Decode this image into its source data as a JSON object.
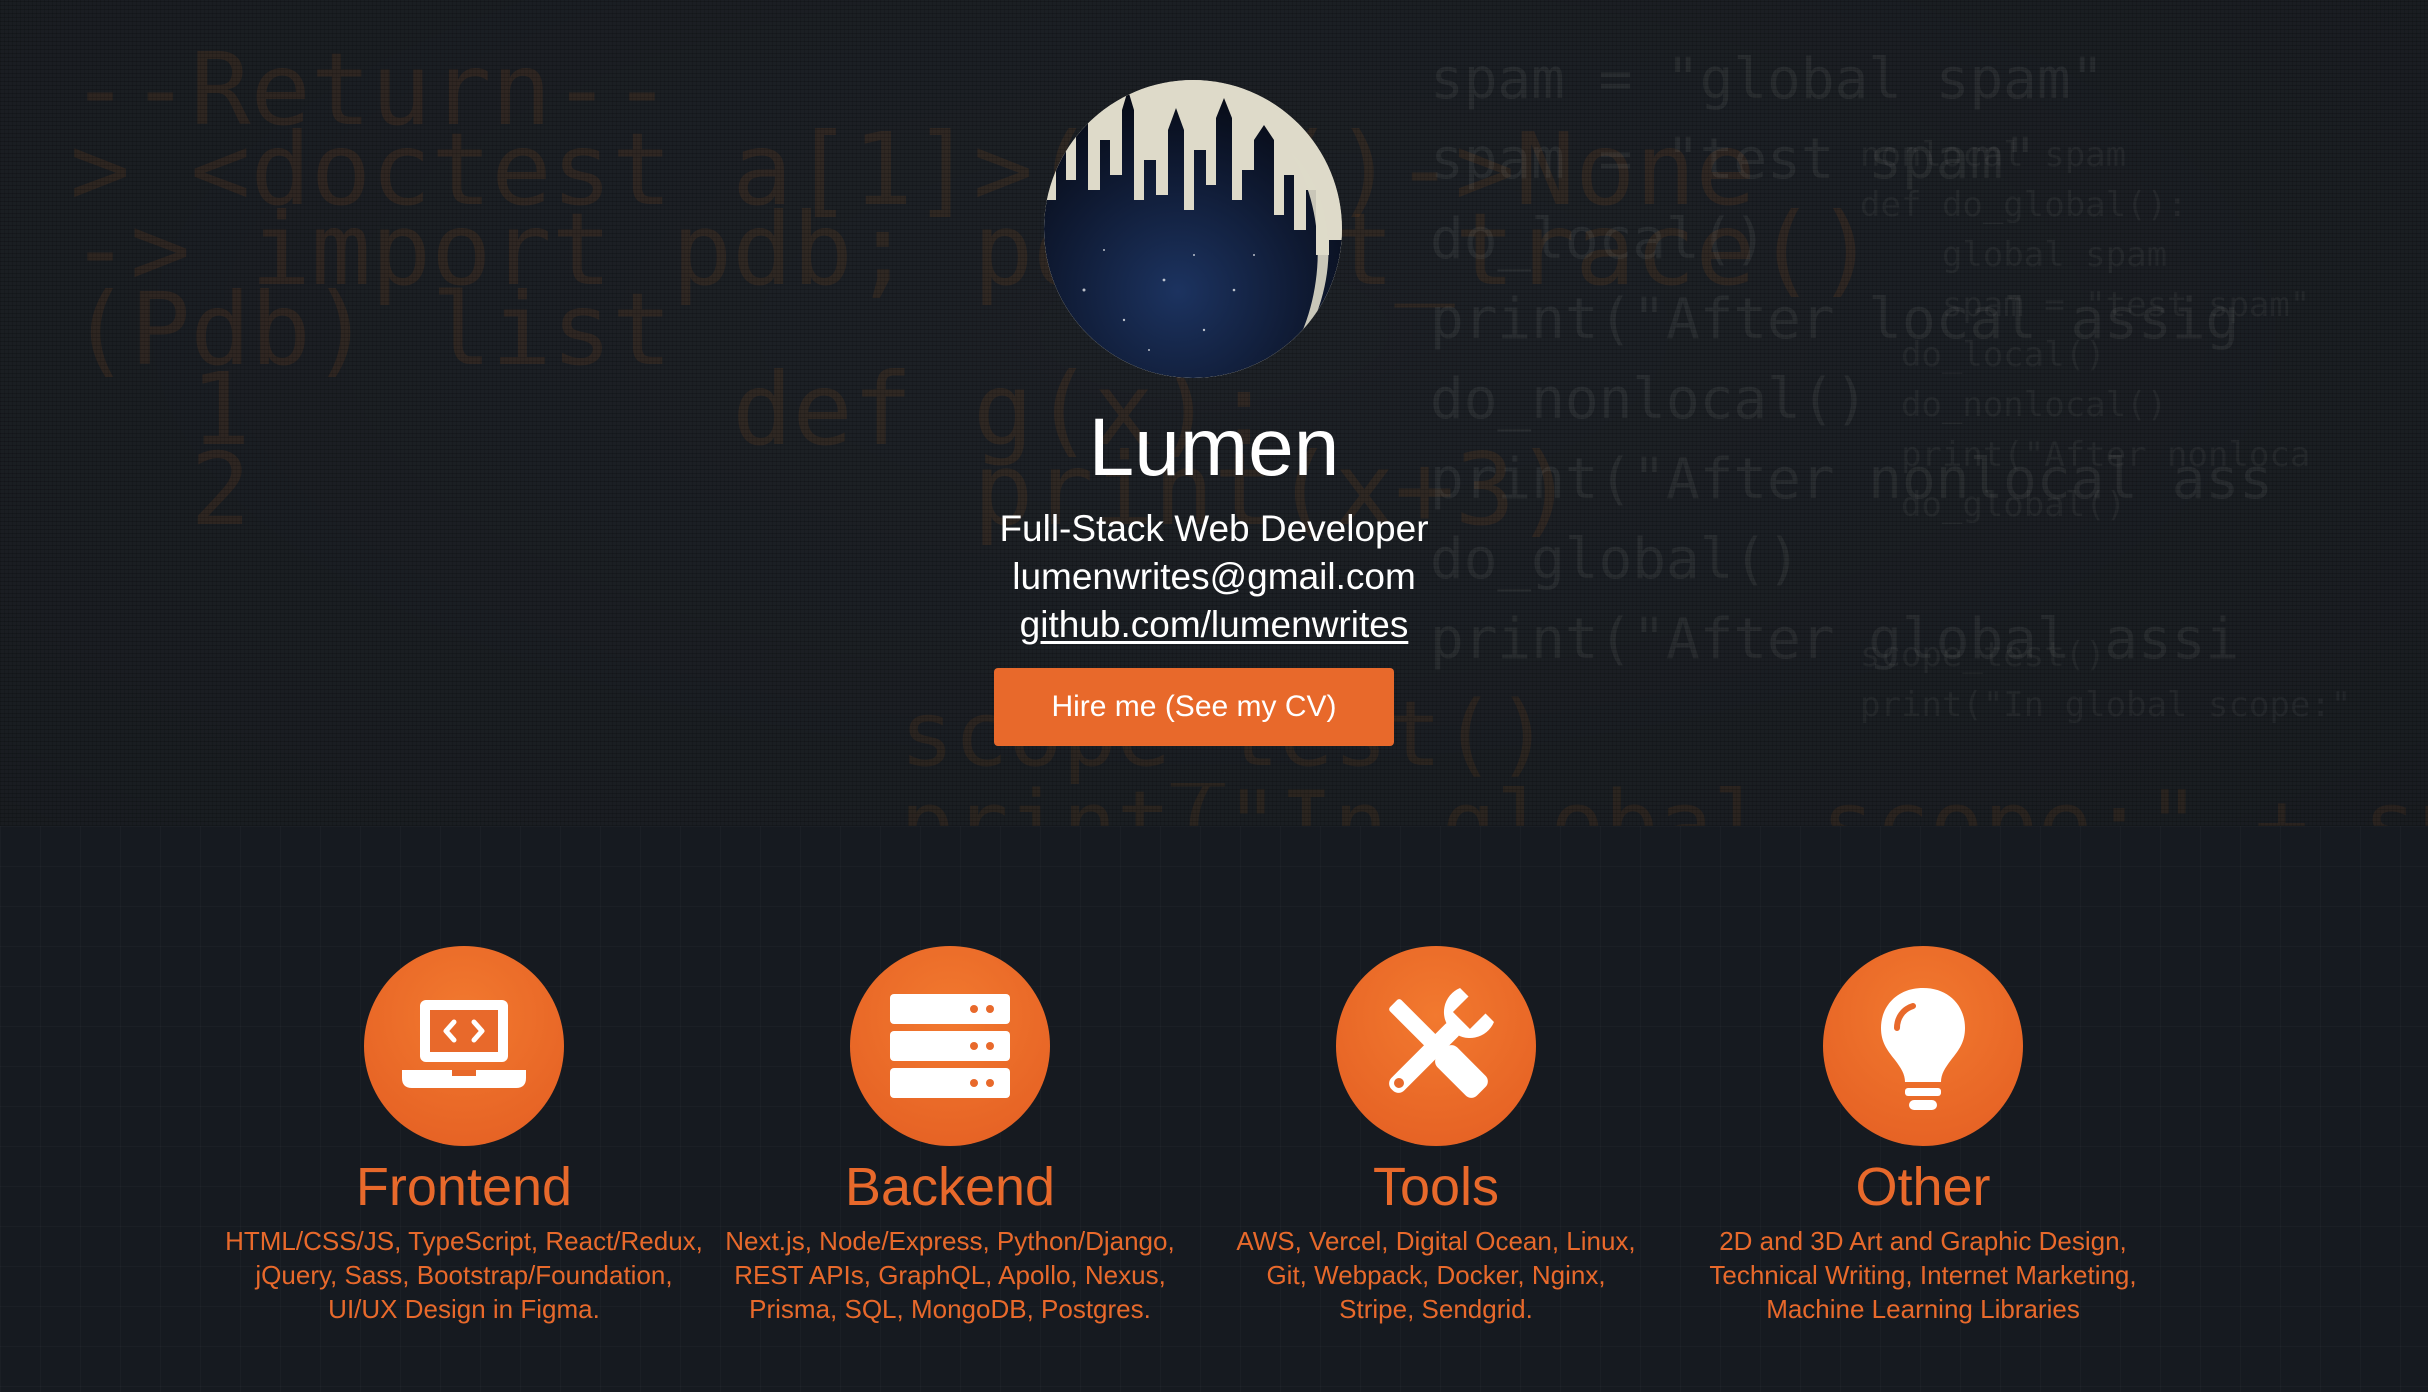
{
  "hero": {
    "name": "Lumen",
    "role": "Full-Stack Web Developer",
    "email": "lumenwrites@gmail.com",
    "github": "github.com/lumenwrites",
    "hire_button": "Hire me (See my CV)",
    "background_code": {
      "left": "--Return--\n> <doctest a[1]>(1)g()->None\n-> import pdb; pdb.set_trace()\n(Pdb) list\n  1        def g(x):\n  2            print(x+3)",
      "right": "spam = \"global spam\"\nspam = \"test spam\"\ndo_local()\nprint(\"After local assig\ndo_nonlocal()\nprint(\"After nonlocal ass\ndo_global()\nprint(\"After global assi",
      "right_small": "nonlocal spam\ndef do_global():\n    global spam\n    spam = \"test spam\"\n  do_local()\n  do_nonlocal()\n  print(\"After nonloca\n  do_global()\n\n\nscope_test()\nprint(\"In global scope:\"",
      "middle": "scope_test()\nprint(\"In global scope:\" + spa"
    }
  },
  "skills": [
    {
      "icon": "laptop-code-icon",
      "title": "Frontend",
      "description": "HTML/CSS/JS, TypeScript, React/Redux,\njQuery, Sass, Bootstrap/Foundation,\nUI/UX Design in Figma."
    },
    {
      "icon": "server-icon",
      "title": "Backend",
      "description": "Next.js, Node/Express, Python/Django,\nREST APIs, GraphQL, Apollo, Nexus,\nPrisma, SQL, MongoDB, Postgres."
    },
    {
      "icon": "tools-icon",
      "title": "Tools",
      "description": "AWS, Vercel, Digital Ocean, Linux,\nGit, Webpack, Docker, Nginx,\nStripe, Sendgrid."
    },
    {
      "icon": "lightbulb-icon",
      "title": "Other",
      "description": "2D and 3D Art and Graphic Design,\nTechnical Writing, Internet Marketing,\nMachine Learning Libraries"
    }
  ],
  "colors": {
    "accent": "#e8692b",
    "hero_bg": "#1d2126",
    "skills_bg": "#161a20",
    "text": "#ffffff"
  }
}
